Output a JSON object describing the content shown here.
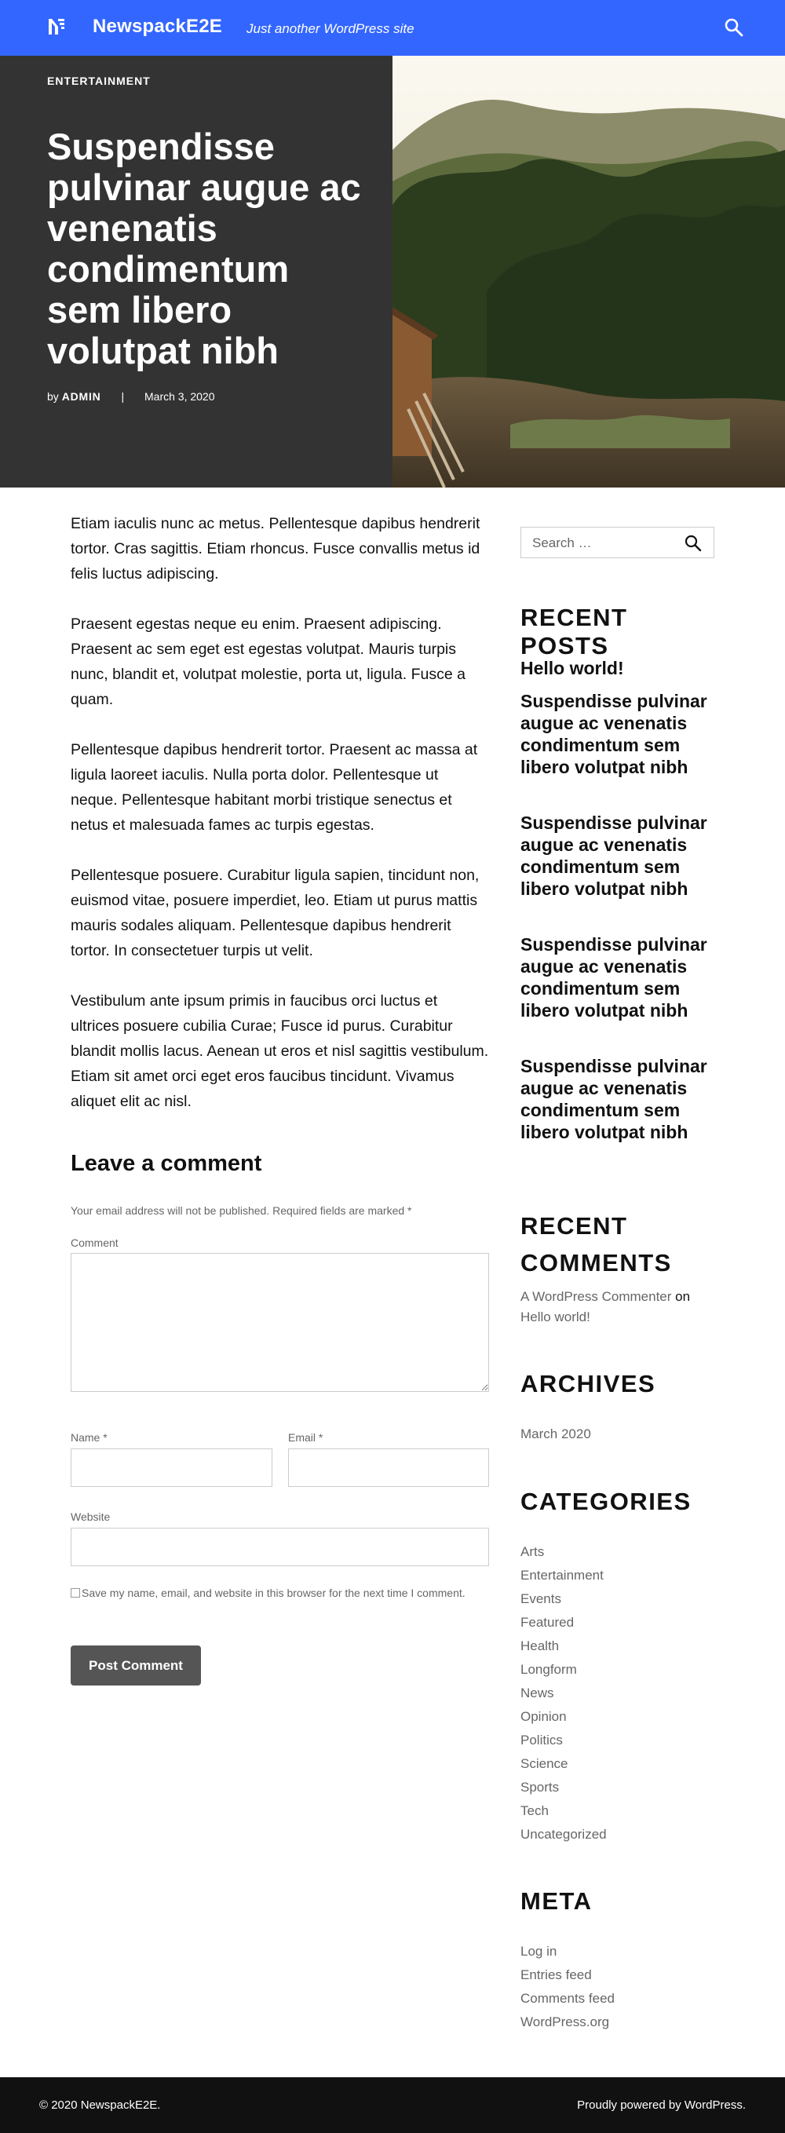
{
  "header": {
    "site_title": "NewspackE2E",
    "tagline": "Just another WordPress site",
    "brand_color": "#3366ff"
  },
  "hero": {
    "category": "ENTERTAINMENT",
    "title": "Suspendisse pulvinar augue ac venenatis condimentum sem libero volutpat nibh",
    "by": "by",
    "author": "ADMIN",
    "separator": "|",
    "date": "March 3, 2020"
  },
  "article": {
    "paragraphs": [
      "Etiam iaculis nunc ac metus. Pellentesque dapibus hendrerit tortor. Cras sagittis. Etiam rhoncus. Fusce convallis metus id felis luctus adipiscing.",
      "Praesent egestas neque eu enim. Praesent adipiscing. Praesent ac sem eget est egestas volutpat. Mauris turpis nunc, blandit et, volutpat molestie, porta ut, ligula. Fusce a quam.",
      "Pellentesque dapibus hendrerit tortor. Praesent ac massa at ligula laoreet iaculis. Nulla porta dolor. Pellentesque ut neque. Pellentesque habitant morbi tristique senectus et netus et malesuada fames ac turpis egestas.",
      "Pellentesque posuere. Curabitur ligula sapien, tincidunt non, euismod vitae, posuere imperdiet, leo. Etiam ut purus mattis mauris sodales aliquam. Pellentesque dapibus hendrerit tortor. In consectetuer turpis ut velit.",
      "Vestibulum ante ipsum primis in faucibus orci luctus et ultrices posuere cubilia Curae; Fusce id purus. Curabitur blandit mollis lacus. Aenean ut eros et nisl sagittis vestibulum. Etiam sit amet orci eget eros faucibus tincidunt. Vivamus aliquet elit ac nisl."
    ]
  },
  "comments": {
    "title": "Leave a comment",
    "note": "Your email address will not be published. Required fields are marked *",
    "comment_label": "Comment",
    "name_label": "Name *",
    "email_label": "Email *",
    "website_label": "Website",
    "save_label": "Save my name, email, and website in this browser for the next time I comment.",
    "submit_label": "Post Comment"
  },
  "sidebar": {
    "search_placeholder": "Search …",
    "recent_posts_title": "RECENT POSTS",
    "recent_posts": [
      "Hello world!",
      "Suspendisse pulvinar augue ac venenatis condimentum sem libero volutpat nibh",
      "Suspendisse pulvinar augue ac venenatis condimentum sem libero volutpat nibh",
      "Suspendisse pulvinar augue ac venenatis condimentum sem libero volutpat nibh",
      "Suspendisse pulvinar augue ac venenatis condimentum sem libero volutpat nibh"
    ],
    "recent_comments_title": "RECENT COMMENTS",
    "recent_comment": {
      "author": "A WordPress Commenter",
      "on": "on",
      "post": "Hello world!"
    },
    "archives_title": "ARCHIVES",
    "archives": [
      "March 2020"
    ],
    "categories_title": "CATEGORIES",
    "categories": [
      "Arts",
      "Entertainment",
      "Events",
      "Featured",
      "Health",
      "Longform",
      "News",
      "Opinion",
      "Politics",
      "Science",
      "Sports",
      "Tech",
      "Uncategorized"
    ],
    "meta_title": "META",
    "meta_links": [
      "Log in",
      "Entries feed",
      "Comments feed",
      "WordPress.org"
    ]
  },
  "footer": {
    "copyright": "© 2020 NewspackE2E.",
    "powered": "Proudly powered by WordPress."
  }
}
